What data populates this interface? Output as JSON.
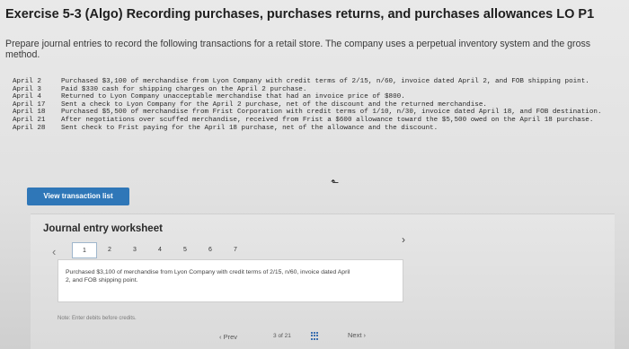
{
  "title": "Exercise 5-3 (Algo) Recording purchases, purchases returns, and purchases allowances LO P1",
  "instructions": "Prepare journal entries to record the following transactions for a retail store. The company uses a perpetual inventory system and the gross method.",
  "transactions": [
    {
      "date": "April 2",
      "text": "Purchased $3,100 of merchandise from Lyon Company with credit terms of 2/15, n/60, invoice dated April 2, and FOB shipping point."
    },
    {
      "date": "April 3",
      "text": "Paid $330 cash for shipping charges on the April 2 purchase."
    },
    {
      "date": "April 4",
      "text": "Returned to Lyon Company unacceptable merchandise that had an invoice price of $800."
    },
    {
      "date": "April 17",
      "text": "Sent a check to Lyon Company for the April 2 purchase, net of the discount and the returned merchandise."
    },
    {
      "date": "April 18",
      "text": "Purchased $5,500 of merchandise from Frist Corporation with credit terms of 1/10, n/30, invoice dated April 18, and FOB destination."
    },
    {
      "date": "April 21",
      "text": "After negotiations over scuffed merchandise, received from Frist a $600 allowance toward the $5,500 owed on the April 18 purchase."
    },
    {
      "date": "April 28",
      "text": "Sent check to Frist paying for the April 18 purchase, net of the allowance and the discount."
    }
  ],
  "view_button": "View transaction list",
  "worksheet": {
    "title": "Journal entry worksheet",
    "steps": [
      "1",
      "2",
      "3",
      "4",
      "5",
      "6",
      "7"
    ],
    "active_step": "1",
    "entry_text": "Purchased $3,100 of merchandise from Lyon Company with credit terms of 2/15, n/60, invoice dated April 2, and FOB shipping point.",
    "note": "Note: Enter debits before credits."
  },
  "pager": {
    "prev": "Prev",
    "current": "3",
    "of": "of",
    "total": "21",
    "next": "Next"
  },
  "icons": [
    "chevron-left-icon",
    "chevron-right-icon",
    "grid-icon",
    "cursor-icon"
  ],
  "colors": {
    "button": "#2f77b8",
    "active_step_border": "#9fb6cc",
    "grid_icon": "#3b6fb0"
  }
}
